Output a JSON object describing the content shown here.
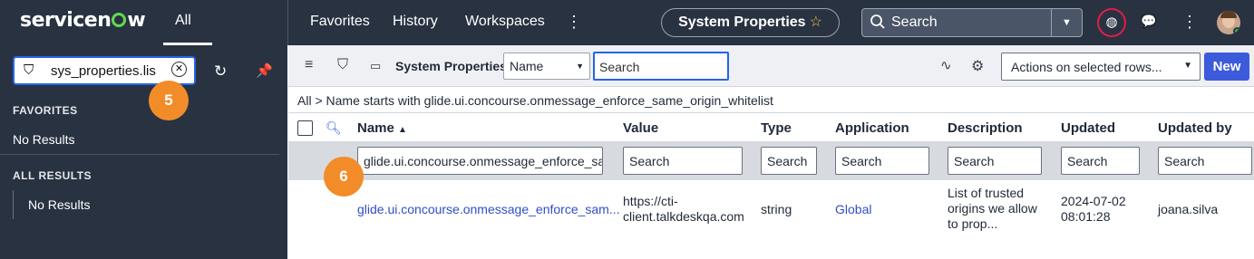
{
  "topnav": {
    "brand": "servicenow",
    "all_label": "All",
    "links": [
      "Favorites",
      "History",
      "Workspaces"
    ],
    "more_glyph": "⋮",
    "context_title": "System Properties",
    "search_placeholder": "Search"
  },
  "sidebar": {
    "filter_value": "sys_properties.lis",
    "badge_5": "5",
    "favorites_heading": "FAVORITES",
    "favorites_empty": "No Results",
    "all_results_heading": "ALL RESULTS",
    "all_results_empty": "No Results"
  },
  "toolbar": {
    "title": "System Properties",
    "field_select": "Name",
    "search_placeholder": "Search",
    "actions_select": "Actions on selected rows...",
    "new_label": "New"
  },
  "breadcrumb": {
    "root": "All",
    "sep": ">",
    "condition": "Name starts with glide.ui.concourse.onmessage_enforce_same_origin_whitelist"
  },
  "table": {
    "columns": [
      "Name",
      "Value",
      "Type",
      "Application",
      "Description",
      "Updated",
      "Updated by"
    ],
    "sort_indicator": "▲",
    "filters": {
      "name": "glide.ui.concourse.onmessage_enforce_sar",
      "placeholder": "Search"
    },
    "badge_6": "6",
    "rows": [
      {
        "name": "glide.ui.concourse.onmessage_enforce_sam...",
        "value_line1": "https://cti-",
        "value_line2": "client.talkdeskqa.com",
        "type": "string",
        "application": "Global",
        "desc_line1": "List of trusted",
        "desc_line2": "origins we allow",
        "desc_line3": "to prop...",
        "updated_line1": "2024-07-02",
        "updated_line2": "08:01:28",
        "updated_by": "joana.silva"
      }
    ]
  },
  "colors": {
    "nav_bg": "#293241",
    "accent_blue": "#3b5bdb",
    "link_blue": "#2f4fc4",
    "badge_orange": "#f28c28",
    "logo_green": "#62d84e"
  }
}
